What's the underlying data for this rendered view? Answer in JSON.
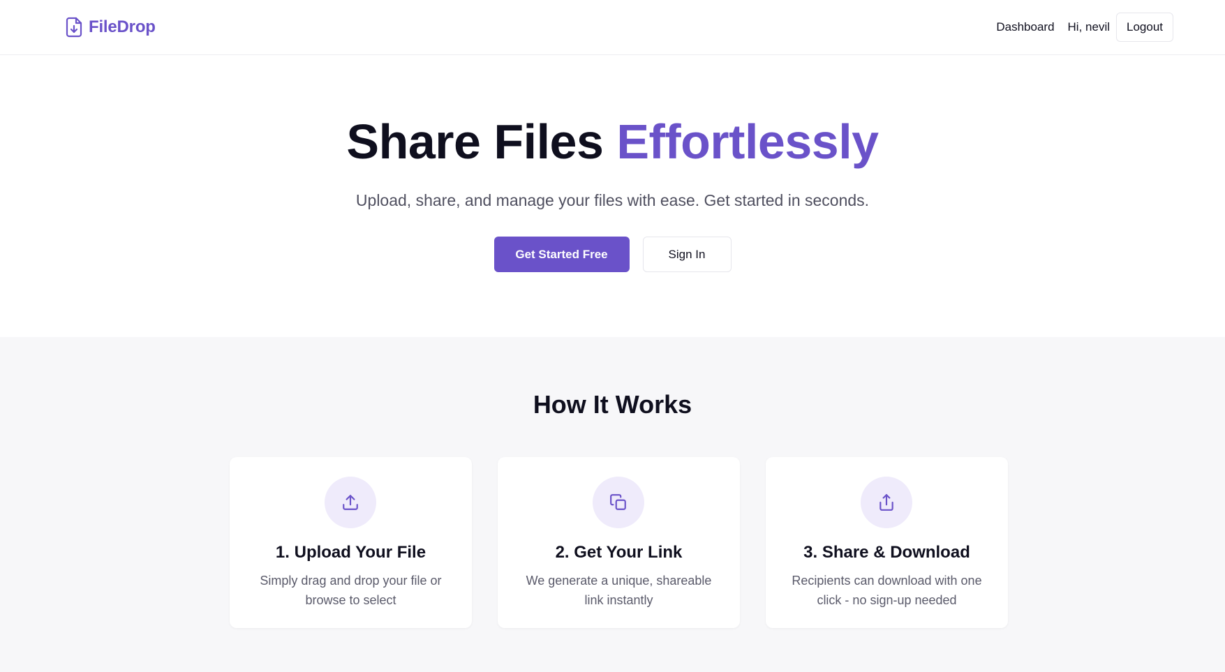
{
  "colors": {
    "brand": "#6a52c9",
    "text": "#0f0f1e",
    "muted": "#4f4f5f",
    "section_bg": "#f7f7f9",
    "icon_bg": "#efebfb"
  },
  "header": {
    "logo_icon": "file-download-icon",
    "logo_text": "FileDrop",
    "nav": {
      "dashboard_label": "Dashboard",
      "greeting": "Hi, nevil",
      "logout_label": "Logout"
    }
  },
  "hero": {
    "title_main": "Share Files ",
    "title_accent": "Effortlessly",
    "subtitle": "Upload, share, and manage your files with ease. Get started in seconds.",
    "primary_button": "Get Started Free",
    "secondary_button": "Sign In"
  },
  "how_it_works": {
    "title": "How It Works",
    "steps": [
      {
        "icon": "upload-icon",
        "title": "1. Upload Your File",
        "description": "Simply drag and drop your file or browse to select"
      },
      {
        "icon": "copy-link-icon",
        "title": "2. Get Your Link",
        "description": "We generate a unique, shareable link instantly"
      },
      {
        "icon": "share-icon",
        "title": "3. Share & Download",
        "description": "Recipients can download with one click - no sign-up needed"
      }
    ]
  }
}
